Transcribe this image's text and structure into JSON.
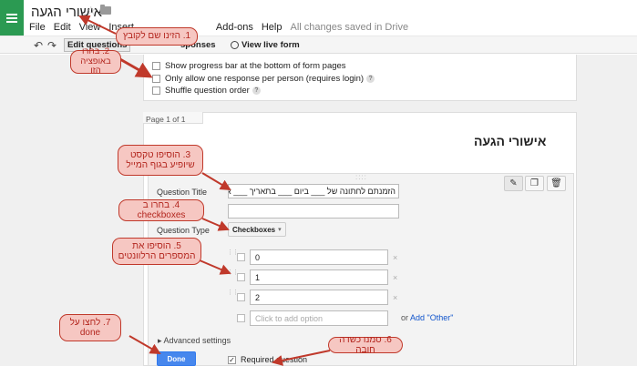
{
  "header": {
    "doc_title": "אישורי הגעה",
    "star_glyph": "☆",
    "menu": [
      "File",
      "Edit",
      "View",
      "Insert",
      "Add-ons",
      "Help"
    ],
    "save_status": "All changes saved in Drive"
  },
  "toolbar": {
    "undo_glyph": "↶",
    "redo_glyph": "↷",
    "edit_questions": "Edit questions",
    "responses_suffix": "sponses",
    "view_live": "View live form"
  },
  "settings": {
    "progress_bar": "Show progress bar at the bottom of form pages",
    "one_response": "Only allow one response per person (requires login)",
    "shuffle": "Shuffle question order",
    "help_glyph": "?"
  },
  "form": {
    "page_label": "Page 1 of 1",
    "title": "אישורי הגעה",
    "drag_handle": "::::",
    "question_title_label": "Question Title",
    "question_title_value": "הזמנתם לחתונה של ___ ביום ___ בתאריך ___ אנא בחרו את מספר האורחים שיגיעו",
    "help_text_value": "",
    "question_type_label": "Question Type",
    "question_type_value": "Checkboxes",
    "caret_glyph": "▾",
    "options": [
      "0",
      "1",
      "2"
    ],
    "add_option_placeholder": "Click to add option",
    "remove_glyph": "×",
    "or_text": "or",
    "add_other": "Add \"Other\"",
    "advanced_settings": "▸ Advanced settings",
    "done_label": "Done",
    "required_label": "Required question",
    "check_glyph": "✓",
    "pencil_glyph": "✎",
    "copy_glyph": "❐",
    "trash_glyph": "🗑"
  },
  "annotations": {
    "a1": "1. הזינו שם לקובץ",
    "a2": "2. בחרו באופציה הזו",
    "a3": "3. הוסיפו טקסט שיופיע בגוף המייל",
    "a4": "4. בחרו ב checkboxes",
    "a5": "5. הוסיפו את המספרים הרלוונטים",
    "a6": "6. סמנו כשדה חובה",
    "a7": "7. לחצו על done"
  },
  "colors": {
    "logo_green": "#2b9a52",
    "done_blue": "#4787ed",
    "callout_fill": "#f6c7c2",
    "callout_border": "#c0392b"
  }
}
